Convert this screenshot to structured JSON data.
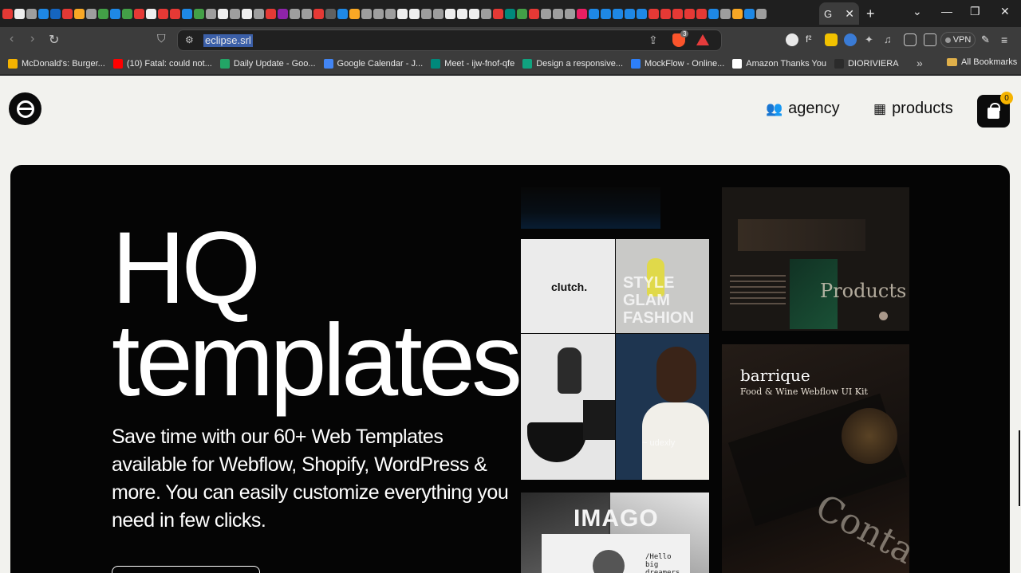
{
  "browser": {
    "tab_glyph": "G",
    "address": "eclipse.srl",
    "shield_count": "3",
    "vpn_label": "VPN",
    "bookmarks": [
      {
        "label": "McDonald's: Burger...",
        "color": "#f5b300"
      },
      {
        "label": "(10) Fatal: could not...",
        "color": "#ff0000"
      },
      {
        "label": "Daily Update - Goo...",
        "color": "#23a566"
      },
      {
        "label": "Google Calendar - J...",
        "color": "#4285f4"
      },
      {
        "label": "Meet - ijw-fnof-qfe",
        "color": "#00897b"
      },
      {
        "label": "Design a responsive...",
        "color": "#10a37f"
      },
      {
        "label": "MockFlow - Online...",
        "color": "#2d7ff9"
      },
      {
        "label": "Amazon Thanks You",
        "color": "#ffffff"
      },
      {
        "label": "DIORIVIERA",
        "color": "#2b2b2b"
      }
    ],
    "all_bookmarks": "All Bookmarks"
  },
  "site": {
    "nav": {
      "agency": "agency",
      "products": "products"
    },
    "cart_count": "0",
    "hero": {
      "title_line1": "HQ",
      "title_line2": "templates",
      "description": "Save time with our 60+ Web Templates available for Webflow, Shopify, WordPress & more. You can easily customize everything you need in few clicks."
    },
    "thumbnails": {
      "clutch": "clutch.",
      "style": "STYLE\nGLAM\nFASHION",
      "udexly": "~ udexly",
      "products": "Products",
      "barrique": "barrique",
      "barrique_sub": "Food & Wine Webflow UI Kit",
      "imago": "IMAGO",
      "hello": "/Hello\nbig\ndreamers",
      "contact": "Contact."
    }
  }
}
